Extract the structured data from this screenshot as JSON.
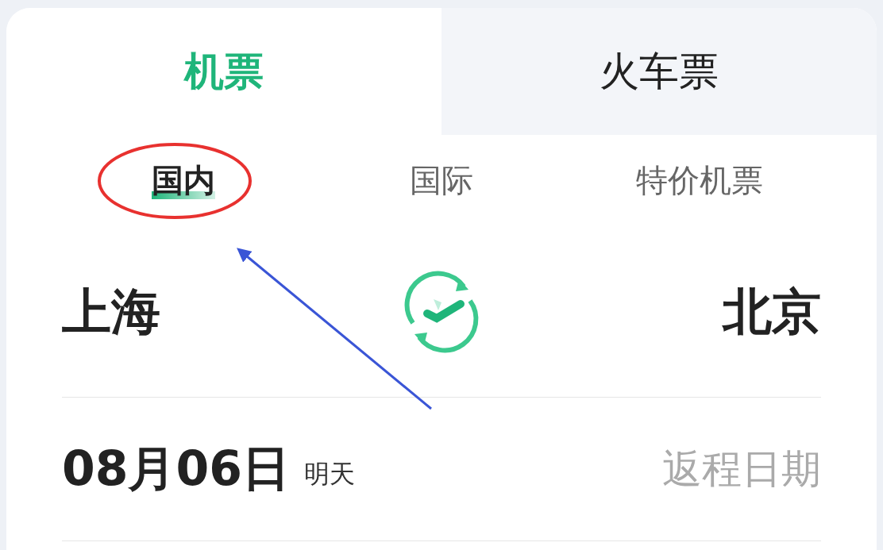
{
  "tabs": [
    {
      "label": "机票",
      "selected": true
    },
    {
      "label": "火车票",
      "selected": false
    }
  ],
  "sub_tabs": [
    {
      "label": "国内",
      "selected": true
    },
    {
      "label": "国际",
      "selected": false
    },
    {
      "label": "特价机票",
      "selected": false
    }
  ],
  "route": {
    "from": "上海",
    "to": "北京"
  },
  "dates": {
    "depart": "08月06日",
    "depart_hint": "明天",
    "return_placeholder": "返程日期"
  },
  "annotations": [
    {
      "kind": "ellipse"
    },
    {
      "kind": "arrow"
    }
  ]
}
